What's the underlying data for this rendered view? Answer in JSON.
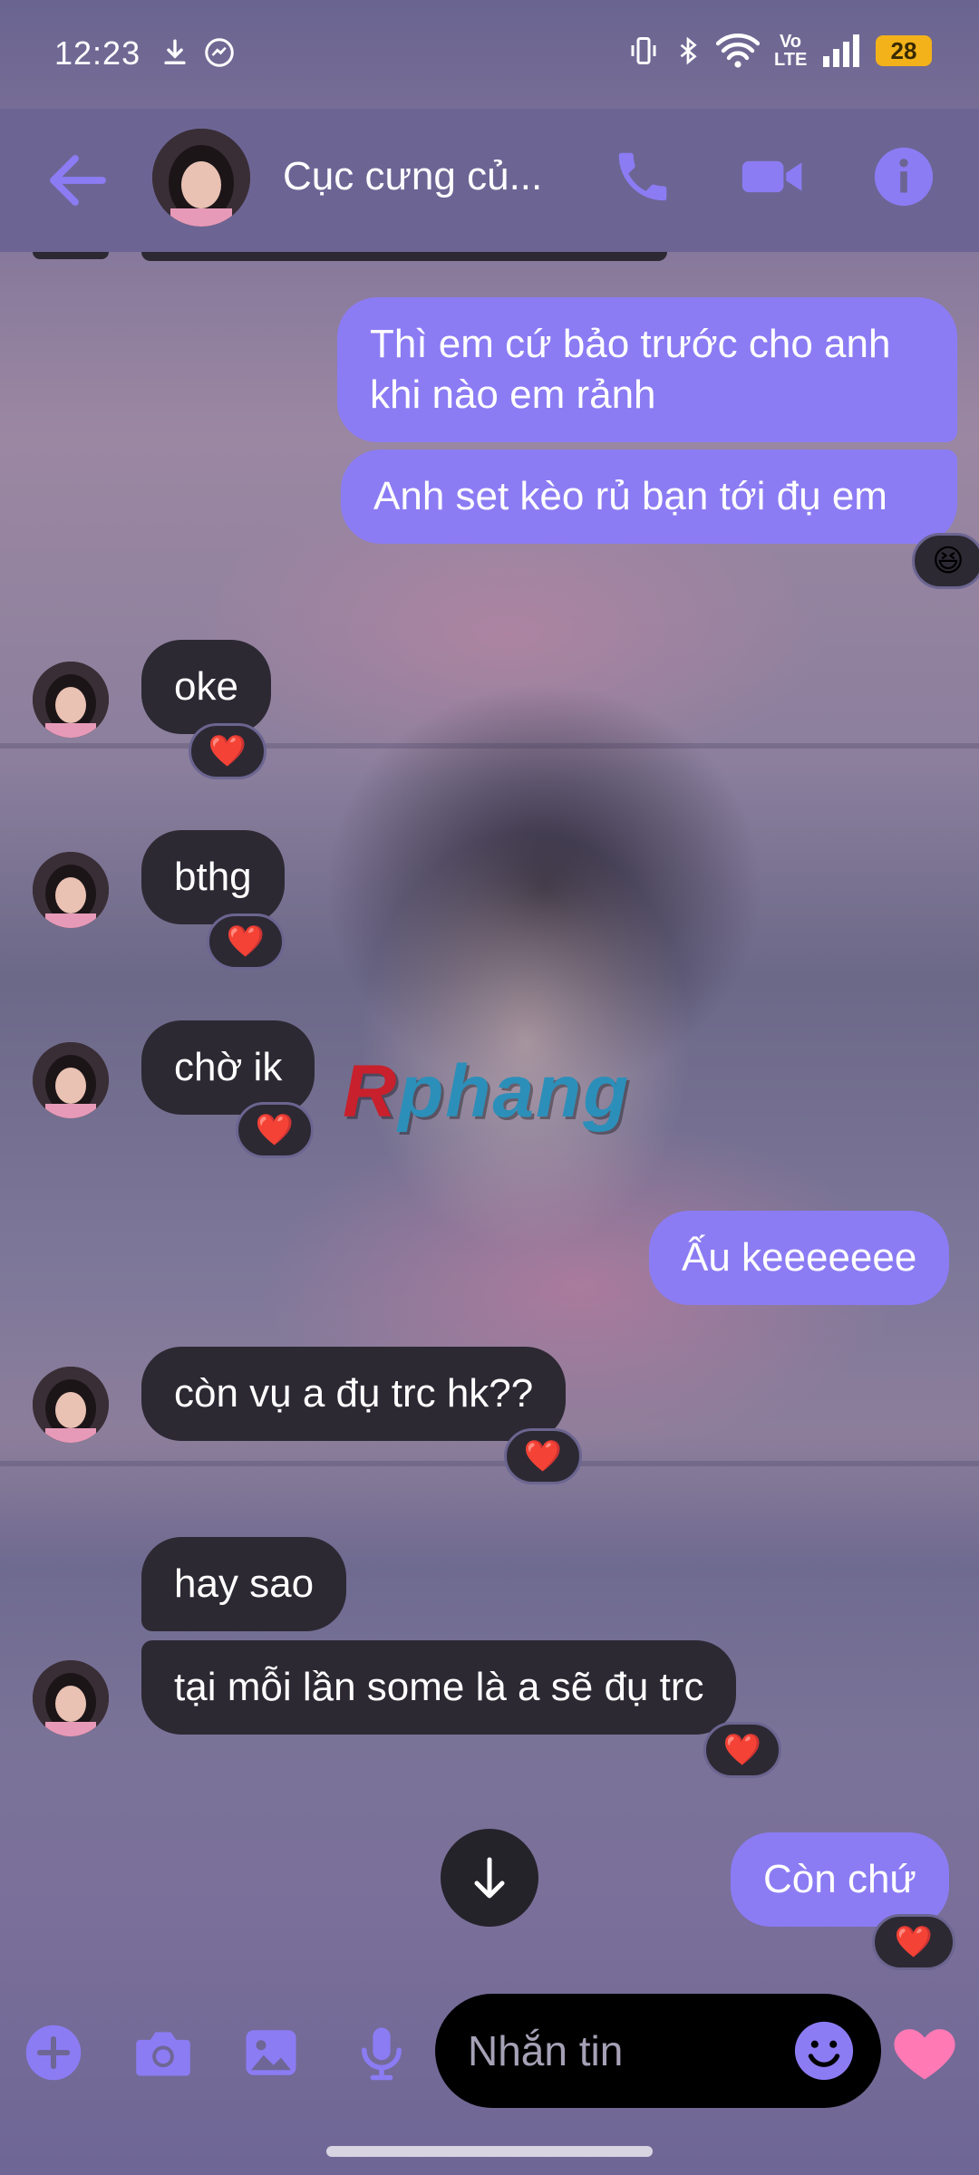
{
  "status_bar": {
    "time": "12:23",
    "network_label": "Vo LTE",
    "battery": "28"
  },
  "header": {
    "contact_name": "Cục cưng củ..."
  },
  "messages": [
    {
      "dir": "out",
      "text": "Thì em cứ bảo trước cho anh khi nào em rảnh"
    },
    {
      "dir": "out",
      "text": "Anh set kèo rủ bạn tới đụ em",
      "reaction": "😆"
    },
    {
      "dir": "in",
      "text": "oke",
      "reaction": "❤️"
    },
    {
      "dir": "in",
      "text": "bthg",
      "reaction": "❤️"
    },
    {
      "dir": "in",
      "text": "chờ ik",
      "reaction": "❤️"
    },
    {
      "dir": "out",
      "text": "Ấu keeeeeee"
    },
    {
      "dir": "in",
      "text": "còn vụ a đụ trc hk??",
      "reaction": "❤️"
    },
    {
      "dir": "in",
      "text": "hay sao"
    },
    {
      "dir": "in",
      "text": "tại mỗi lần some là a sẽ đụ trc",
      "reaction": "❤️"
    },
    {
      "dir": "out",
      "text": "Còn chứ",
      "reaction": "❤️"
    }
  ],
  "watermark": {
    "first": "R",
    "rest": "phang"
  },
  "composer": {
    "placeholder": "Nhắn tin"
  },
  "colors": {
    "accent": "#8b7cf4",
    "header_bg": "#6c6594",
    "incoming_bubble": "#2c2933",
    "heart": "#ff4d8a"
  },
  "icons": [
    "back-arrow-icon",
    "phone-icon",
    "video-icon",
    "info-icon",
    "plus-icon",
    "camera-icon",
    "image-icon",
    "mic-icon",
    "emoji-icon",
    "heart-icon",
    "arrow-down-icon"
  ]
}
